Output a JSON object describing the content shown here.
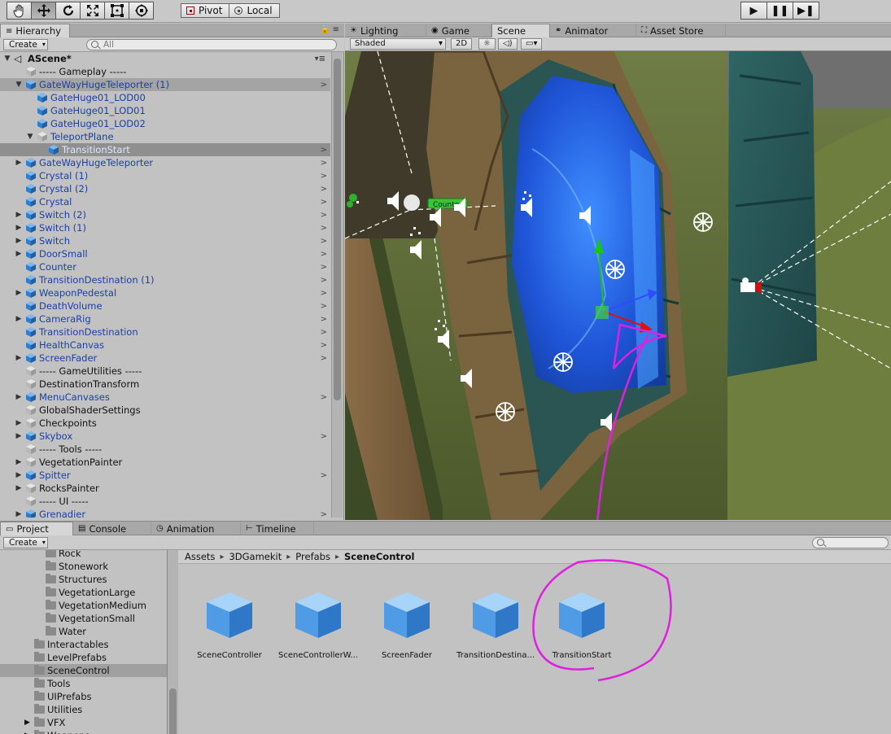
{
  "toolbar": {
    "tools": [
      "hand-tool",
      "move-tool",
      "rotate-tool",
      "scale-tool",
      "rect-tool",
      "transform-tool"
    ],
    "pivot_label": "Pivot",
    "local_label": "Local"
  },
  "hierarchy": {
    "tab_label": "Hierarchy",
    "create_label": "Create",
    "search_placeholder": "All",
    "scene_name": "AScene*",
    "items": [
      {
        "label": "----- Gameplay -----"
      },
      {
        "label": "GateWayHugeTeleporter (1)"
      },
      {
        "label": "GateHuge01_LOD00"
      },
      {
        "label": "GateHuge01_LOD01"
      },
      {
        "label": "GateHuge01_LOD02"
      },
      {
        "label": "TeleportPlane"
      },
      {
        "label": "TransitionStart"
      },
      {
        "label": "GateWayHugeTeleporter"
      },
      {
        "label": "Crystal (1)"
      },
      {
        "label": "Crystal (2)"
      },
      {
        "label": "Crystal"
      },
      {
        "label": "Switch (2)"
      },
      {
        "label": "Switch (1)"
      },
      {
        "label": "Switch"
      },
      {
        "label": "DoorSmall"
      },
      {
        "label": "Counter"
      },
      {
        "label": "TransitionDestination (1)"
      },
      {
        "label": "WeaponPedestal"
      },
      {
        "label": "DeathVolume"
      },
      {
        "label": "CameraRig"
      },
      {
        "label": "TransitionDestination"
      },
      {
        "label": "HealthCanvas"
      },
      {
        "label": "ScreenFader"
      },
      {
        "label": "----- GameUtilities -----"
      },
      {
        "label": "DestinationTransform"
      },
      {
        "label": "MenuCanvases"
      },
      {
        "label": "GlobalShaderSettings"
      },
      {
        "label": "Checkpoints"
      },
      {
        "label": "Skybox"
      },
      {
        "label": "----- Tools -----"
      },
      {
        "label": "VegetationPainter"
      },
      {
        "label": "Spitter"
      },
      {
        "label": "RocksPainter"
      },
      {
        "label": "----- UI -----"
      },
      {
        "label": "Grenadier"
      }
    ]
  },
  "scene": {
    "tabs": [
      {
        "label": "Lighting"
      },
      {
        "label": "Game"
      },
      {
        "label": "Scene"
      },
      {
        "label": "Animator"
      },
      {
        "label": "Asset Store"
      }
    ],
    "shading_mode": "Shaded",
    "mode_2d": "2D",
    "counter_tag": "Counter"
  },
  "project": {
    "tabs": [
      {
        "label": "Project"
      },
      {
        "label": "Console"
      },
      {
        "label": "Animation"
      },
      {
        "label": "Timeline"
      }
    ],
    "create_label": "Create",
    "folders": [
      {
        "label": "Rock"
      },
      {
        "label": "Stonework"
      },
      {
        "label": "Structures"
      },
      {
        "label": "VegetationLarge"
      },
      {
        "label": "VegetationMedium"
      },
      {
        "label": "VegetationSmall"
      },
      {
        "label": "Water"
      },
      {
        "label": "Interactables"
      },
      {
        "label": "LevelPrefabs"
      },
      {
        "label": "SceneControl"
      },
      {
        "label": "Tools"
      },
      {
        "label": "UIPrefabs"
      },
      {
        "label": "Utilities"
      },
      {
        "label": "VFX"
      },
      {
        "label": "Weapons"
      }
    ],
    "breadcrumb": [
      "Assets",
      "3DGamekit",
      "Prefabs",
      "SceneControl"
    ],
    "assets": [
      {
        "label": "SceneController"
      },
      {
        "label": "SceneControllerW..."
      },
      {
        "label": "ScreenFader"
      },
      {
        "label": "TransitionDestina..."
      },
      {
        "label": "TransitionStart"
      }
    ]
  },
  "colors": {
    "annotation": "#e020e0",
    "selection_text": "#dde9ff",
    "prefab_blue": "#1a3fa6"
  }
}
